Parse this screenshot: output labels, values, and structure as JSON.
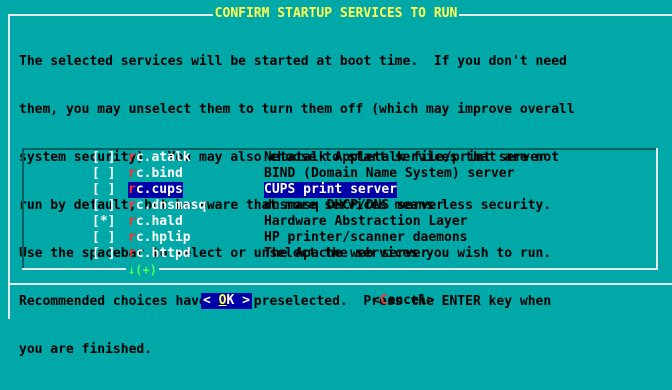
{
  "dialog": {
    "title": "CONFIRM STARTUP SERVICES TO RUN",
    "description_lines": [
      "The selected services will be started at boot time.  If you don't need",
      "them, you may unselect them to turn them off (which may improve overall",
      "system security).  You may also choose to start services that are not",
      "run by default, but be aware that more services means less security.",
      "Use the spacebar to select or unselect the services you wish to run.",
      "Recommended choices have been preselected.  Press the ENTER key when",
      "you are finished."
    ]
  },
  "services": [
    {
      "checkbox": "[ ]",
      "prefix": "r",
      "name": "c.atalk",
      "description": "Netatalk Appletalk file/print server",
      "selected": false
    },
    {
      "checkbox": "[ ]",
      "prefix": "r",
      "name": "c.bind",
      "description": "BIND (Domain Name System) server",
      "selected": false
    },
    {
      "checkbox": "[ ]",
      "prefix": "r",
      "name": "c.cups",
      "description": "CUPS print server",
      "selected": false
    },
    {
      "checkbox": "[ ]",
      "prefix": "r",
      "name": "c.dnsmasq",
      "description": "dnsmasq DHCP/DNS server",
      "selected": false
    },
    {
      "checkbox": "[*]",
      "prefix": "r",
      "name": "c.hald",
      "description": "Hardware Abstraction Layer",
      "selected": true
    },
    {
      "checkbox": "[ ]",
      "prefix": "r",
      "name": "c.hplip",
      "description": "HP printer/scanner daemons",
      "selected": false
    },
    {
      "checkbox": "[ ]",
      "prefix": "r",
      "name": "c.httpd",
      "description": "The Apache web server",
      "selected": false
    }
  ],
  "scroll_indicator": "↓(+)",
  "buttons": {
    "ok": {
      "left": "<",
      "hot": "O",
      "rest": "K",
      "right": ">",
      "pad_left": " ",
      "pad_right": " "
    },
    "cancel": {
      "left": "<",
      "hot": "C",
      "rest": "ancel",
      "right": ">"
    }
  },
  "colors": {
    "background": "#00a8a8",
    "title": "#ffff54",
    "highlight": "#0000a8",
    "hotkey": "#ff3030",
    "scroll_indicator": "#54ff54"
  }
}
